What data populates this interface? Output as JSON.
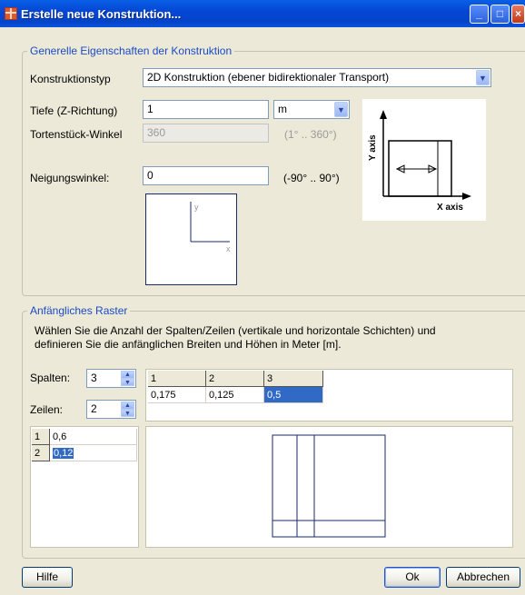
{
  "window": {
    "title": "Erstelle neue Konstruktion..."
  },
  "general": {
    "legend": "Generelle Eigenschaften der Konstruktion",
    "type_label": "Konstruktionstyp",
    "type_value": "2D Konstruktion (ebener bidirektionaler Transport)",
    "depth_label": "Tiefe (Z-Richtung)",
    "depth_value": "1",
    "depth_unit": "m",
    "wedge_label": "Tortenstück-Winkel",
    "wedge_value": "360",
    "wedge_range": "(1° .. 360°)",
    "incline_label": "Neigungswinkel:",
    "incline_value": "0",
    "incline_range": "(-90° .. 90°)",
    "axis_x": "X axis",
    "axis_y": "Y axis",
    "small_x": "x",
    "small_y": "y"
  },
  "grid": {
    "legend": "Anfängliches Raster",
    "description": "Wählen Sie die Anzahl der Spalten/Zeilen (vertikale und horizontale Schichten) und definieren Sie die anfänglichen Breiten und Höhen in Meter [m].",
    "cols_label": "Spalten:",
    "cols_value": "3",
    "rows_label": "Zeilen:",
    "rows_value": "2",
    "col_headers": [
      "1",
      "2",
      "3"
    ],
    "col_widths": [
      "0,175",
      "0,125",
      "0,5"
    ],
    "row_headers": [
      "1",
      "2"
    ],
    "row_heights": [
      "0,6",
      "0,12"
    ]
  },
  "footer": {
    "help": "Hilfe",
    "ok": "Ok",
    "cancel": "Abbrechen"
  },
  "icons": {
    "minimize": "minimize-icon",
    "maximize": "maximize-icon",
    "close": "close-icon",
    "dropdown": "chevron-down-icon",
    "spin": "spinner-arrows-icon"
  },
  "colors": {
    "titlebar": "#0447d4",
    "legend_text": "#1a4bc5",
    "selection": "#316ac5",
    "dialog_bg": "#ece9d8"
  }
}
